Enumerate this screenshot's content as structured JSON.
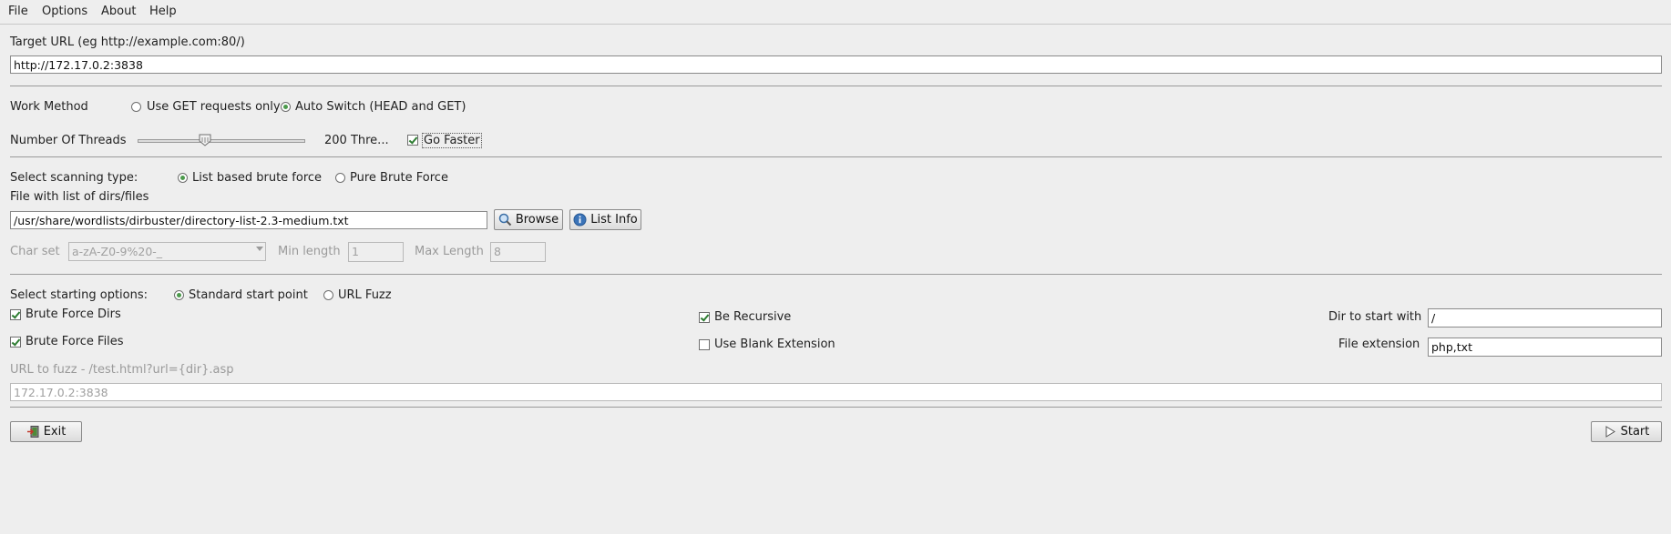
{
  "menu": {
    "items": [
      "File",
      "Options",
      "About",
      "Help"
    ]
  },
  "target": {
    "label": "Target URL (eg http://example.com:80/)",
    "value": "http://172.17.0.2:3838"
  },
  "work_method": {
    "label": "Work Method",
    "options": [
      "Use GET requests only",
      "Auto Switch (HEAD and GET)"
    ],
    "selected": "Auto Switch (HEAD and GET)"
  },
  "threads": {
    "label": "Number Of Threads",
    "value_text": "200 Thre...",
    "slider_fraction": 0.4,
    "go_faster_label": "Go Faster",
    "go_faster_checked": true
  },
  "scan_type": {
    "label": "Select scanning type:",
    "options": [
      "List based brute force",
      "Pure Brute Force"
    ],
    "selected": "List based brute force"
  },
  "wordlist": {
    "label": "File with list of dirs/files",
    "value": "/usr/share/wordlists/dirbuster/directory-list-2.3-medium.txt",
    "browse_label": "Browse",
    "list_info_label": "List Info"
  },
  "charset": {
    "label": "Char set",
    "value": "a-zA-Z0-9%20-_",
    "min_label": "Min length",
    "min_value": "1",
    "max_label": "Max Length",
    "max_value": "8"
  },
  "start_options": {
    "label": "Select starting options:",
    "options": [
      "Standard start point",
      "URL Fuzz"
    ],
    "selected": "Standard start point",
    "brute_dirs_label": "Brute Force Dirs",
    "brute_files_label": "Brute Force Files",
    "recursive_label": "Be Recursive",
    "blank_ext_label": "Use Blank Extension",
    "dir_start_label": "Dir to start with",
    "dir_start_value": "/",
    "file_ext_label": "File extension",
    "file_ext_value": "php,txt"
  },
  "fuzz": {
    "label": "URL to fuzz - /test.html?url={dir}.asp",
    "value": "172.17.0.2:3838"
  },
  "footer": {
    "exit_label": "Exit",
    "start_label": "Start"
  },
  "colors": {
    "background": "#eeeeee",
    "radio_selected": "#4c9a4c",
    "check_mark": "#2e7d32"
  }
}
